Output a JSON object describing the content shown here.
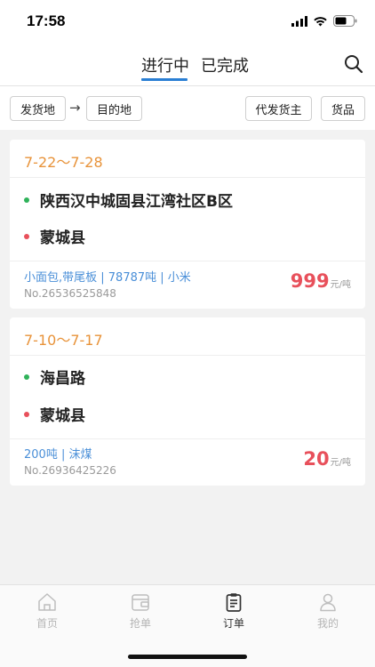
{
  "status_bar": {
    "time": "17:58"
  },
  "header": {
    "tabs": [
      {
        "label": "进行中",
        "active": true
      },
      {
        "label": "已完成",
        "active": false
      }
    ],
    "accent_color": "#2a7fd4"
  },
  "filters": {
    "origin_label": "发货地",
    "arrow": "→",
    "destination_label": "目的地",
    "shipper_label": "代发货主",
    "goods_label": "货品"
  },
  "orders": [
    {
      "date_range": "7-22～7-28",
      "origin": "陕西汉中城固县江湾社区B区",
      "destination": "蒙城县",
      "details": "小面包,带尾板 | 78787吨 | 小米",
      "order_no": "No.26536525848",
      "price": "999",
      "price_unit": "元/吨"
    },
    {
      "date_range": "7-10～7-17",
      "origin": "海昌路",
      "destination": "蒙城县",
      "details": "200吨 | 沫煤",
      "order_no": "No.26936425226",
      "price": "20",
      "price_unit": "元/吨"
    }
  ],
  "tabbar": {
    "items": [
      {
        "label": "首页",
        "icon": "home-icon",
        "active": false
      },
      {
        "label": "抢单",
        "icon": "wallet-icon",
        "active": false
      },
      {
        "label": "订单",
        "icon": "clipboard-icon",
        "active": true
      },
      {
        "label": "我的",
        "icon": "person-icon",
        "active": false
      }
    ]
  },
  "colors": {
    "date": "#e8933a",
    "origin_dot": "#2fb25a",
    "destination_dot": "#e8505b",
    "price": "#e8505b",
    "details": "#4a8fd8"
  }
}
